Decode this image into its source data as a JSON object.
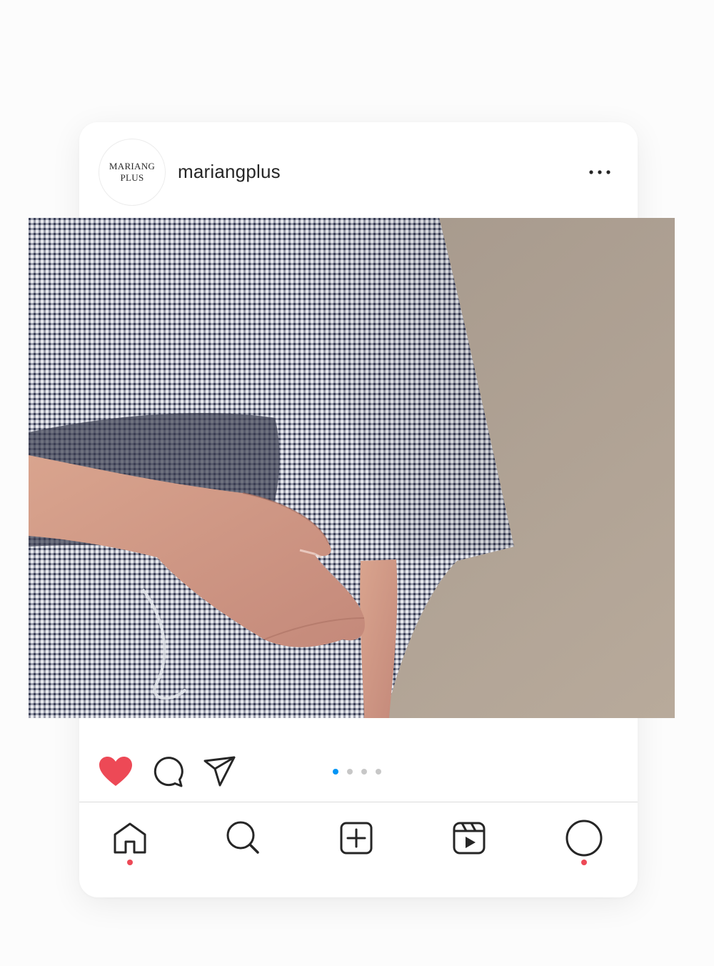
{
  "post": {
    "account": {
      "username": "mariangplus",
      "avatar_line1": "MARIANG",
      "avatar_line2": "PLUS"
    },
    "liked": true,
    "carousel": {
      "count": 4,
      "active_index": 0
    }
  },
  "nav": {
    "items": [
      "home-icon",
      "search-icon",
      "create-post-icon",
      "reels-icon",
      "profile-icon"
    ],
    "notification_dots": [
      "home",
      "profile"
    ]
  },
  "colors": {
    "like": "#ed4956",
    "carousel_active": "#0095f6",
    "carousel_inactive": "#c7c7c7",
    "notification_dot": "#ed4956",
    "icon": "#262626"
  }
}
